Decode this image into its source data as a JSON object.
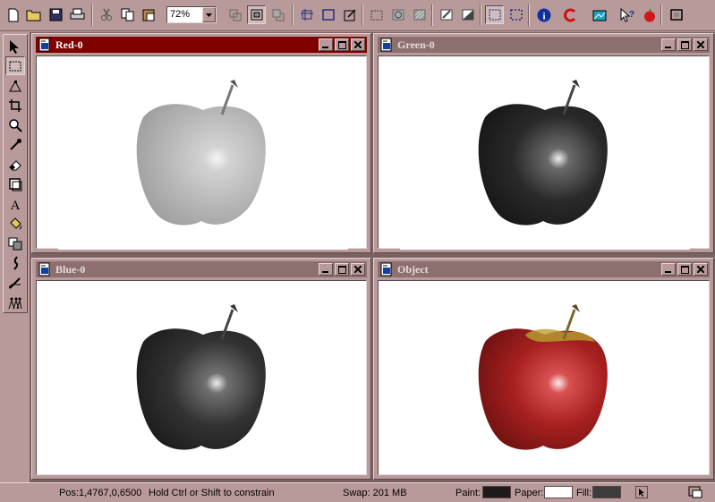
{
  "toolbar": {
    "zoom_value": "72%",
    "buttons": [
      "new-icon",
      "open-icon",
      "save-icon",
      "print-icon",
      "cut-icon",
      "copy-icon",
      "paste-icon"
    ]
  },
  "windows": [
    {
      "title": "Red-0",
      "active": true,
      "channel": "red"
    },
    {
      "title": "Green-0",
      "active": false,
      "channel": "green"
    },
    {
      "title": "Blue-0",
      "active": false,
      "channel": "blue"
    },
    {
      "title": "Object",
      "active": false,
      "channel": "color"
    }
  ],
  "status": {
    "position": "Pos:1,4767,0,6500",
    "hint": "Hold Ctrl or Shift to constrain",
    "swap": "Swap: 201 MB",
    "paint_label": "Paint:",
    "paper_label": "Paper:",
    "fill_label": "Fill:",
    "paint_color": "#1e1a1a",
    "paper_color": "#ffffff",
    "fill_color": "#3c3c3c"
  },
  "colors": {
    "chrome": "#b99a9a",
    "active_title": "#800000",
    "inactive_title": "#8c7070"
  }
}
